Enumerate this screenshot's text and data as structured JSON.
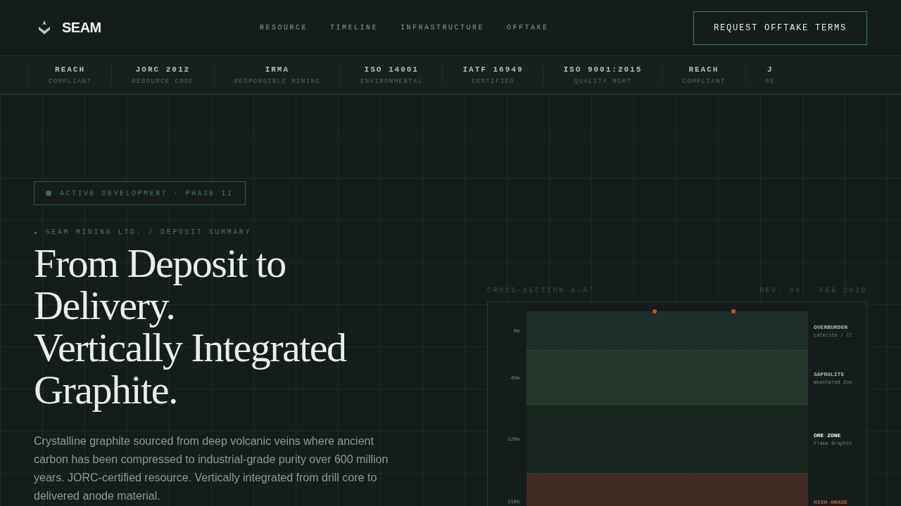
{
  "header": {
    "brand": "SEAM",
    "nav": [
      {
        "label": "RESOURCE"
      },
      {
        "label": "TIMELINE"
      },
      {
        "label": "INFRASTRUCTURE"
      },
      {
        "label": "OFFTAKE"
      }
    ],
    "cta": "REQUEST OFFTAKE TERMS"
  },
  "certifications": [
    {
      "title": "REACH",
      "subtitle": "COMPLIANT"
    },
    {
      "title": "JORC 2012",
      "subtitle": "RESOURCE CODE"
    },
    {
      "title": "IRMA",
      "subtitle": "RESPONSIBLE MINING"
    },
    {
      "title": "ISO 14001",
      "subtitle": "ENVIRONMENTAL"
    },
    {
      "title": "IATF 16949",
      "subtitle": "CERTIFIED"
    },
    {
      "title": "ISO 9001:2015",
      "subtitle": "QUALITY MGMT"
    },
    {
      "title": "REACH",
      "subtitle": "COMPLIANT"
    },
    {
      "title": "J",
      "subtitle": "RE"
    }
  ],
  "hero": {
    "status_badge": "ACTIVE DEVELOPMENT · PHASE II",
    "breadcrumb_marker": "▸",
    "breadcrumb": "SEAM MINING LTD. / DEPOSIT SUMMARY",
    "headline_lines": [
      "From Deposit to",
      "Delivery.",
      "Vertically Integrated",
      "Graphite."
    ],
    "description": "Crystalline graphite sourced from deep volcanic veins where ancient carbon has been compressed to industrial-grade purity over 600 million years. JORC-certified resource. Vertically integrated from drill core to delivered anode material."
  },
  "cross_section": {
    "title": "CROSS-SECTION A–A'",
    "revision": "REV. 04 · FEB 2026",
    "layers": [
      {
        "depth": "0m",
        "name": "OVERBURDEN",
        "detail": "Laterite / Cl",
        "kind": "overburden"
      },
      {
        "depth": "45m",
        "name": "SAPROLITE",
        "detail": "Weathered Zon",
        "kind": "saprolite"
      },
      {
        "depth": "120m",
        "name": "ORE ZONE",
        "detail": "Flake Graphit",
        "kind": "ore"
      },
      {
        "depth": "210m",
        "name": "HIGH-GRADE",
        "kind": "high-grade"
      }
    ]
  }
}
